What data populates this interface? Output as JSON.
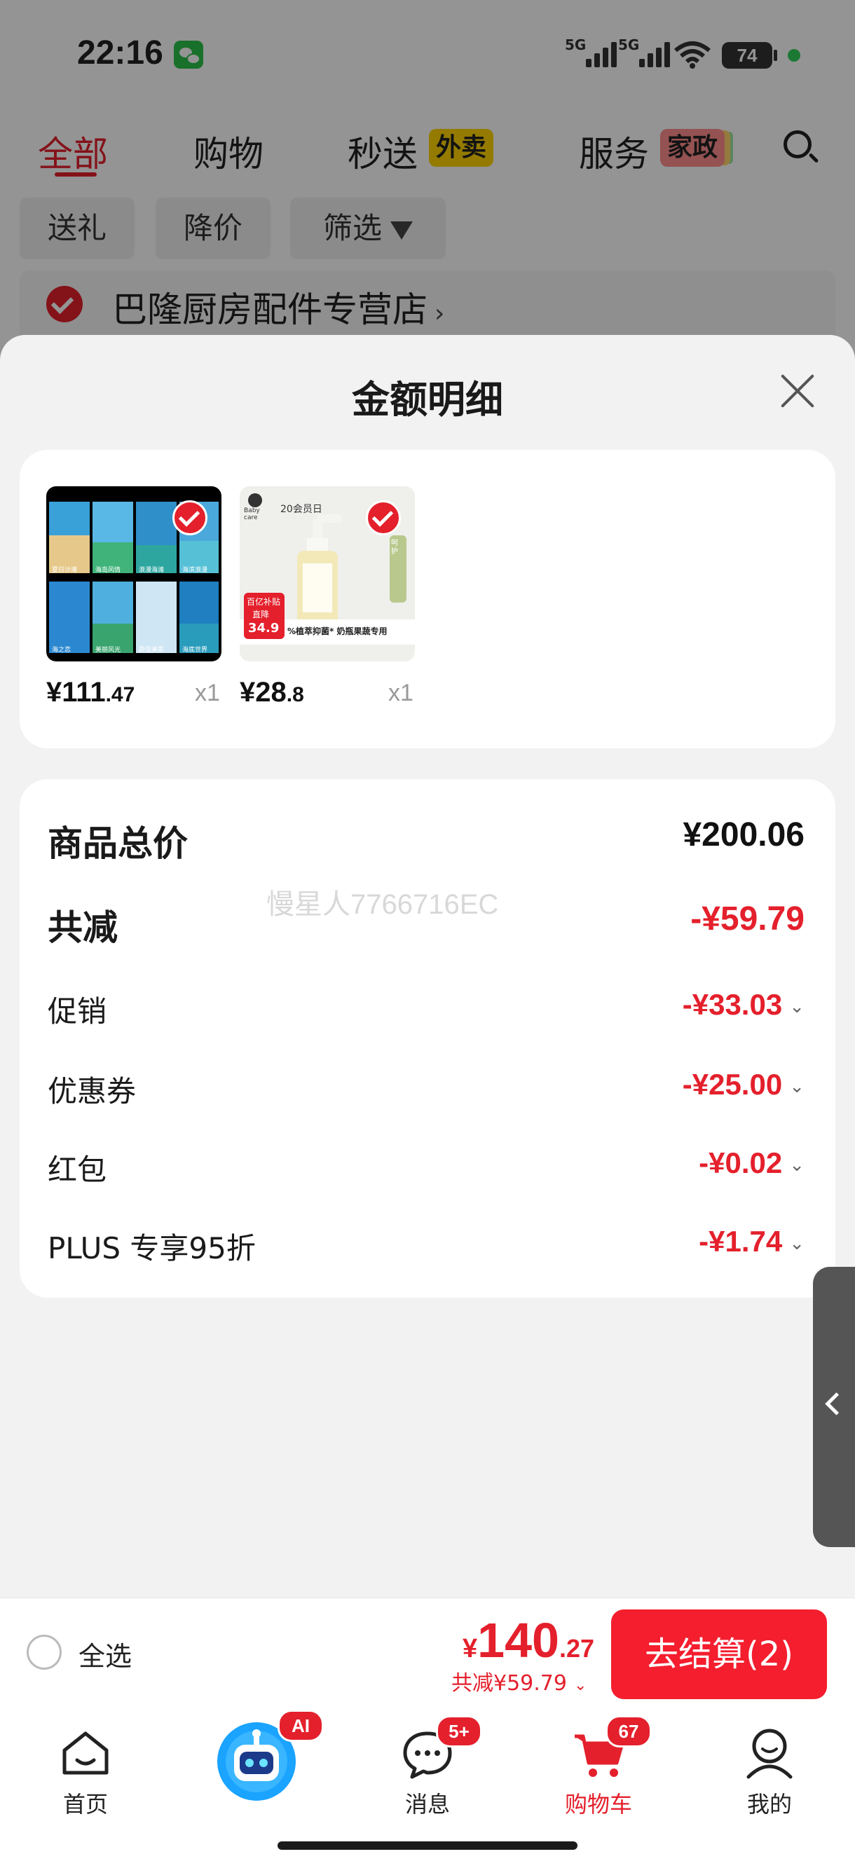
{
  "status_bar": {
    "time": "22:16",
    "net1": "5G",
    "net2": "5G",
    "battery": "74"
  },
  "top_tabs": {
    "all": "全部",
    "shopping": "购物",
    "express": "秒送",
    "express_tag": "外卖",
    "service": "服务",
    "service_tag": "家政"
  },
  "chips": {
    "gift": "送礼",
    "price_drop": "降价",
    "filter": "筛选"
  },
  "store": {
    "name": "巴隆厨房配件专营店",
    "arrow": "›"
  },
  "sheet": {
    "title": "金额明细"
  },
  "products": [
    {
      "price_int": "¥111",
      "price_dec": ".47",
      "qty": "x1",
      "tiles": [
        "夏日沙滩",
        "海岛风情",
        "浪漫海滩",
        "海滨浪漫",
        "海之恋",
        "美丽风光",
        "蔚蓝美景",
        "海底世界"
      ]
    },
    {
      "price_int": "¥28",
      "price_dec": ".8",
      "qty": "x1",
      "brand": "Baby care",
      "event": "20会员日",
      "subsidy": "百亿补贴",
      "subsidy2": "直降",
      "promo_price": "34.9",
      "slogan": "%植萃抑菌* 奶瓶果蔬专用",
      "side_tag": "呵护"
    }
  ],
  "summary": {
    "total_label": "商品总价",
    "total_value": "¥200.06",
    "saved_label": "共减",
    "saved_value": "-¥59.79",
    "promo_label": "促销",
    "promo_value": "-¥33.03",
    "coupon_label": "优惠券",
    "coupon_value": "-¥25.00",
    "redpacket_label": "红包",
    "redpacket_value": "-¥0.02",
    "plus_label": "PLUS 专享95折",
    "plus_value": "-¥1.74",
    "watermark": "慢星人7766716EC"
  },
  "checkout": {
    "select_all": "全选",
    "yen": "¥",
    "total_int": "140",
    "total_dec": ".27",
    "saved": "共减¥59.79",
    "button": "去结算(2)"
  },
  "nav": {
    "home": "首页",
    "ai_badge": "AI",
    "messages": "消息",
    "messages_badge": "5+",
    "cart": "购物车",
    "cart_badge": "67",
    "mine": "我的"
  },
  "colors": {
    "accent": "#e4202c",
    "checkout_button": "#f41e2e",
    "yellow_tag": "#ffd400"
  }
}
